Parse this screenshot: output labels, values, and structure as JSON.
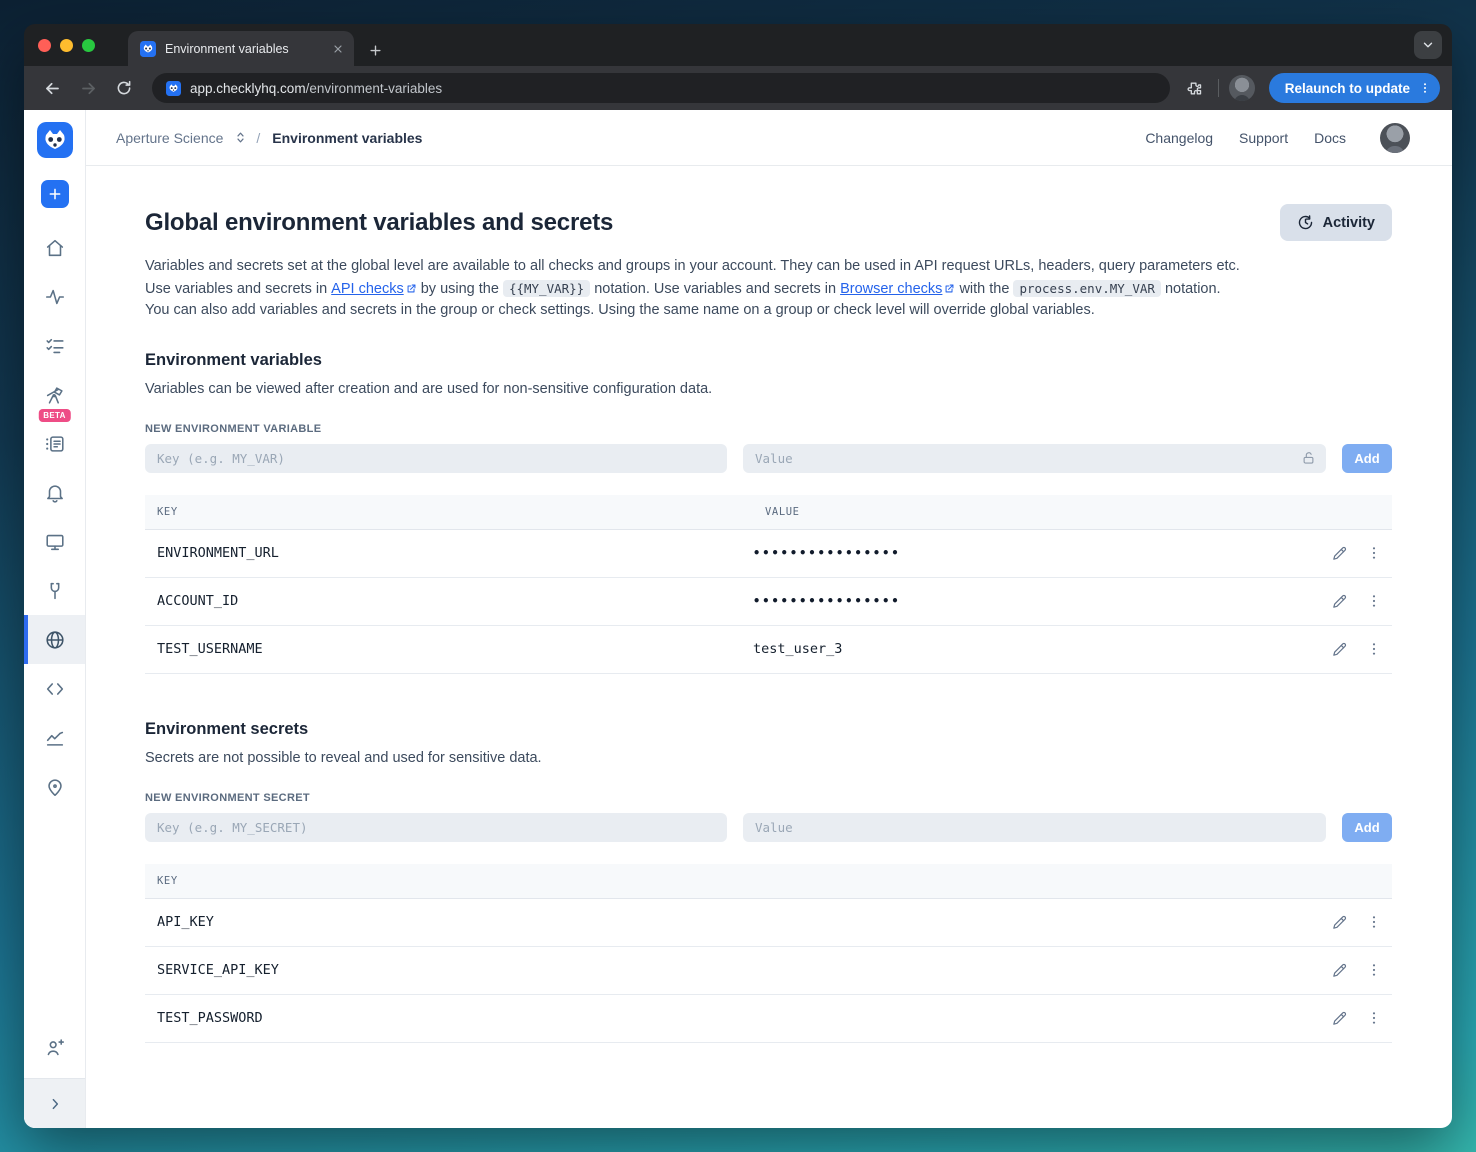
{
  "browser": {
    "tab_title": "Environment variables",
    "url_domain": "app.checklyhq.com",
    "url_path": "/environment-variables",
    "relaunch_label": "Relaunch to update"
  },
  "header": {
    "account": "Aperture Science",
    "separator": "/",
    "current": "Environment variables",
    "links": {
      "changelog": "Changelog",
      "support": "Support",
      "docs": "Docs"
    }
  },
  "sidebar": {
    "beta_badge": "BETA",
    "items": [
      {
        "icon": "home-icon"
      },
      {
        "icon": "pulse-icon"
      },
      {
        "icon": "checklist-icon"
      },
      {
        "icon": "telescope-icon",
        "badge": "BETA"
      },
      {
        "icon": "logs-icon"
      },
      {
        "icon": "bell-icon"
      },
      {
        "icon": "monitor-icon"
      },
      {
        "icon": "maintenance-icon"
      },
      {
        "icon": "globe-icon",
        "active": true
      },
      {
        "icon": "code-icon"
      },
      {
        "icon": "chart-icon"
      },
      {
        "icon": "pin-icon"
      }
    ]
  },
  "page": {
    "title": "Global environment variables and secrets",
    "activity_button": "Activity",
    "intro_segments": [
      {
        "t": "text",
        "v": "Variables and secrets set at the global level are available to all checks and groups in your account. They can be used in API request URLs, headers, query parameters etc. Use variables and secrets in "
      },
      {
        "t": "link",
        "v": "API checks"
      },
      {
        "t": "text",
        "v": " by using the "
      },
      {
        "t": "code",
        "v": "{{MY_VAR}}"
      },
      {
        "t": "text",
        "v": " notation. Use variables and secrets in "
      },
      {
        "t": "link",
        "v": "Browser checks"
      },
      {
        "t": "text",
        "v": " with the "
      },
      {
        "t": "code",
        "v": "process.env.MY_VAR"
      },
      {
        "t": "text",
        "v": " notation. You can also add variables and secrets in the group or check settings. Using the same name on a group or check level will override global variables."
      }
    ]
  },
  "variables_section": {
    "title": "Environment variables",
    "description": "Variables can be viewed after creation and are used for non-sensitive configuration data.",
    "form_label": "NEW ENVIRONMENT VARIABLE",
    "key_placeholder": "Key (e.g. MY_VAR)",
    "value_placeholder": "Value",
    "add_label": "Add",
    "table": {
      "headers": [
        "KEY",
        "VALUE"
      ],
      "rows": [
        {
          "key": "ENVIRONMENT_URL",
          "value": "••••••••••••••••",
          "masked": true
        },
        {
          "key": "ACCOUNT_ID",
          "value": "••••••••••••••••",
          "masked": true
        },
        {
          "key": "TEST_USERNAME",
          "value": "test_user_3",
          "masked": false
        }
      ]
    }
  },
  "secrets_section": {
    "title": "Environment secrets",
    "description": "Secrets are not possible to reveal and used for sensitive data.",
    "form_label": "NEW ENVIRONMENT SECRET",
    "key_placeholder": "Key (e.g. MY_SECRET)",
    "value_placeholder": "Value",
    "add_label": "Add",
    "table": {
      "headers": [
        "KEY"
      ],
      "rows": [
        {
          "key": "API_KEY"
        },
        {
          "key": "SERVICE_API_KEY"
        },
        {
          "key": "TEST_PASSWORD"
        }
      ]
    }
  }
}
